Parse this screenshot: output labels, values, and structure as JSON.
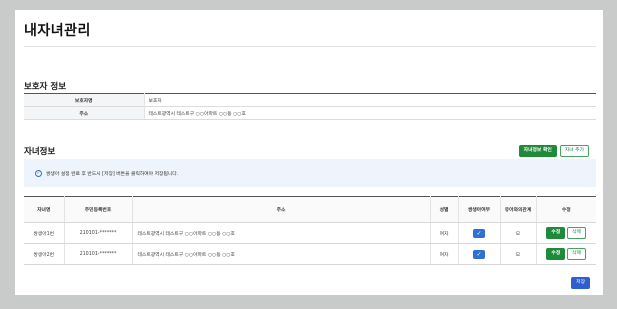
{
  "page": {
    "title": "내자녀관리"
  },
  "guardian": {
    "section_title": "보호자 정보",
    "rows": [
      {
        "label": "보호자명",
        "value": "보호자"
      },
      {
        "label": "주소",
        "value": "테스트광역시 테스트구 ○○아파트 ○○동 ○○호"
      }
    ]
  },
  "children": {
    "section_title": "자녀정보",
    "confirm_label": "자녀정보 확인",
    "add_label": "자녀 추가",
    "notice": "쌍생아 설정 완료 후 반드시 [저장] 버튼을 클릭하여야 저장됩니다.",
    "headers": [
      "자녀명",
      "주민등록번호",
      "주소",
      "성별",
      "쌍생아여부",
      "유아와의관계",
      "수정"
    ],
    "rows": [
      {
        "name": "쌍생아1번",
        "rrn": "210101-*******",
        "address": "테스트광역시 테스트구 ○○아파트 ○○동 ○○호",
        "gender": "여자",
        "twin": true,
        "relation": "모",
        "edit": "수정",
        "delete": "삭제"
      },
      {
        "name": "쌍생아2번",
        "rrn": "210101-*******",
        "address": "테스트광역시 테스트구 ○○아파트 ○○동 ○○호",
        "gender": "여자",
        "twin": true,
        "relation": "모",
        "edit": "수정",
        "delete": "삭제"
      }
    ]
  },
  "save_label": "저장",
  "colors": {
    "accent_green": "#1f8a3a",
    "accent_blue": "#2f5fcf",
    "notice_bg": "#eef4fb"
  }
}
